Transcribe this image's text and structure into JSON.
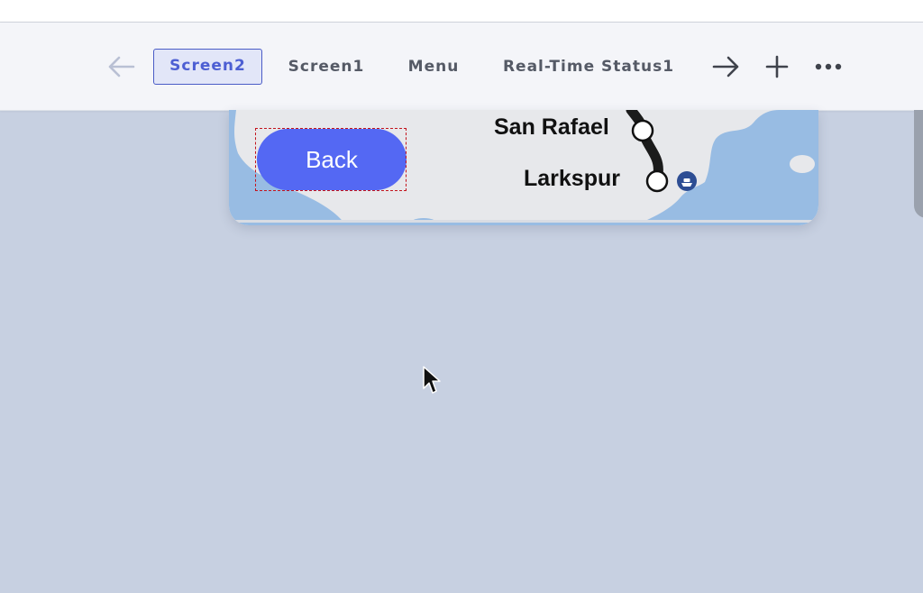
{
  "toolbar": {
    "tabs": [
      {
        "label": "Screen2",
        "active": true
      },
      {
        "label": "Screen1",
        "active": false
      },
      {
        "label": "Menu",
        "active": false
      },
      {
        "label": "Real-Time Status1",
        "active": false
      }
    ],
    "icons": {
      "back": "arrow-left-icon",
      "forward": "arrow-right-icon",
      "add": "plus-icon",
      "more": "more-horizontal-icon"
    }
  },
  "preview": {
    "back_button_label": "Back",
    "stations": [
      "San Rafael",
      "Larkspur"
    ],
    "ferry_icon": "ferry-icon"
  },
  "colors": {
    "accent": "#4d5fd3",
    "button": "#5468f3",
    "water": "#98bce3",
    "land": "#e7e8eb",
    "canvas": "#c7d0e1",
    "selection": "#c3141d"
  }
}
